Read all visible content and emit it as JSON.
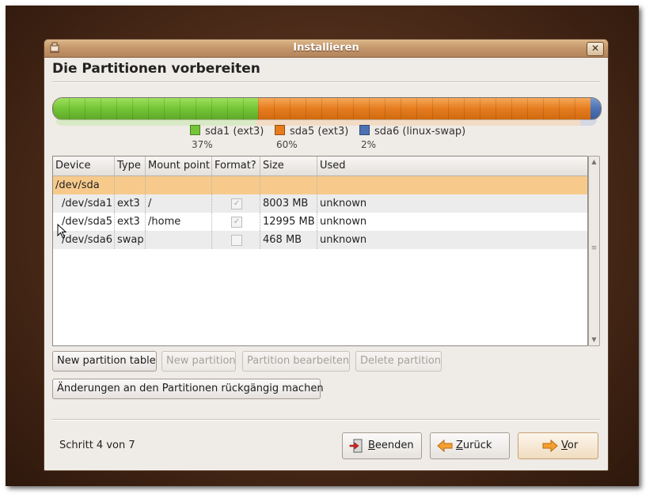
{
  "window": {
    "title": "Installieren",
    "close_glyph": "✕",
    "icon": "installer-icon"
  },
  "page": {
    "heading": "Die Partitionen vorbereiten"
  },
  "partition_bar": {
    "segments": [
      {
        "name": "sda1",
        "fs": "ext3",
        "label": "sda1 (ext3)",
        "percent_label": "37%",
        "share": 0.37,
        "color": "#74c536"
      },
      {
        "name": "sda5",
        "fs": "ext3",
        "label": "sda5 (ext3)",
        "percent_label": "60%",
        "share": 0.6,
        "color": "#e67c1e"
      },
      {
        "name": "sda6",
        "fs": "linux-swap",
        "label": "sda6 (linux-swap)",
        "percent_label": "2%",
        "share": 0.02,
        "color": "#4c72b4"
      }
    ]
  },
  "table": {
    "columns": [
      "Device",
      "Type",
      "Mount point",
      "Format?",
      "Size",
      "Used"
    ],
    "rows": [
      {
        "device": "/dev/sda",
        "type": "",
        "mount": "",
        "format": null,
        "size": "",
        "used": "",
        "selected": true
      },
      {
        "device": "/dev/sda1",
        "type": "ext3",
        "mount": "/",
        "format": true,
        "size": "8003 MB",
        "used": "unknown"
      },
      {
        "device": "/dev/sda5",
        "type": "ext3",
        "mount": "/home",
        "format": true,
        "size": "12995 MB",
        "used": "unknown"
      },
      {
        "device": "/dev/sda6",
        "type": "swap",
        "mount": "",
        "format": false,
        "size": "468 MB",
        "used": "unknown"
      }
    ],
    "check_glyph": "✓"
  },
  "buttons": {
    "new_partition_table": "New partition table",
    "new_partition": "New partition",
    "edit_partition": "Partition bearbeiten",
    "delete_partition": "Delete partition",
    "undo_changes": "Änderungen an den Partitionen rückgängig machen"
  },
  "footer": {
    "step": "Schritt 4 von 7",
    "quit": {
      "mnemonic": "B",
      "rest": "eenden"
    },
    "back": {
      "mnemonic": "Z",
      "rest": "urück"
    },
    "forward": {
      "mnemonic": "V",
      "rest": "or"
    }
  },
  "colors": {
    "accent": "#e67c1e",
    "selection": "#f7ca8c",
    "titlebar": "#c4966a"
  }
}
